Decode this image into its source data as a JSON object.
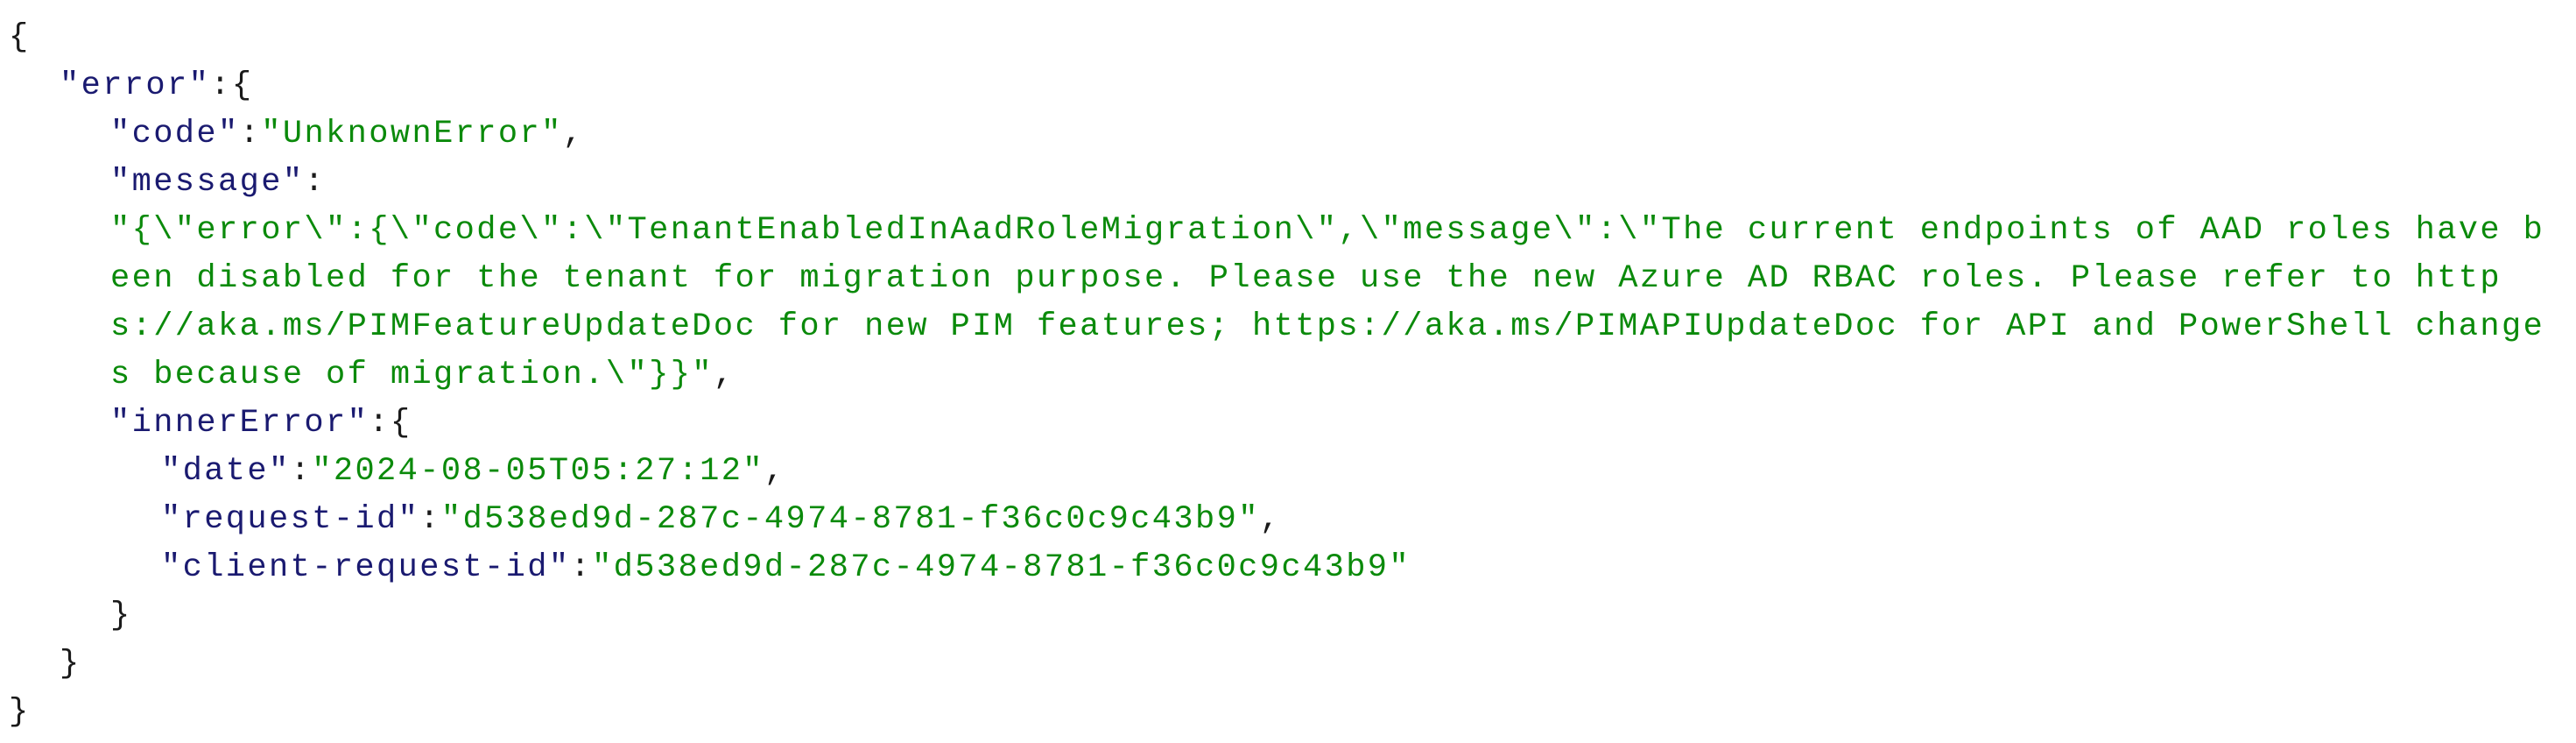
{
  "json": {
    "open_brace": "{",
    "close_brace": "}",
    "error_key": "\"error\"",
    "code_key": "\"code\"",
    "code_value": "\"UnknownError\"",
    "message_key": "\"message\"",
    "message_value": "\"{\\\"error\\\":{\\\"code\\\":\\\"TenantEnabledInAadRoleMigration\\\",\\\"message\\\":\\\"The current endpoints of AAD roles have been disabled for the tenant for migration purpose. Please use the new Azure AD RBAC roles. Please refer to https://aka.ms/PIMFeatureUpdateDoc for new PIM features; https://aka.ms/PIMAPIUpdateDoc for API and PowerShell changes because of migration.\\\"}}\"",
    "inner_error_key": "\"innerError\"",
    "date_key": "\"date\"",
    "date_value": "\"2024-08-05T05:27:12\"",
    "request_id_key": "\"request-id\"",
    "request_id_value": "\"d538ed9d-287c-4974-8781-f36c0c9c43b9\"",
    "client_request_id_key": "\"client-request-id\"",
    "client_request_id_value": "\"d538ed9d-287c-4974-8781-f36c0c9c43b9\""
  }
}
